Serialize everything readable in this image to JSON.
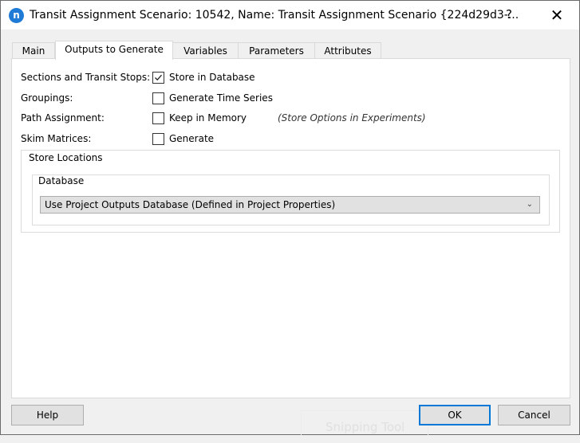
{
  "window": {
    "title": "Transit Assignment Scenario: 10542, Name: Transit Assignment Scenario  {224d29d3-...",
    "app_icon_glyph": "n",
    "help_glyph": "?",
    "close_glyph": "✕"
  },
  "tabs": [
    {
      "label": "Main",
      "active": false
    },
    {
      "label": "Outputs to Generate",
      "active": true
    },
    {
      "label": "Variables",
      "active": false
    },
    {
      "label": "Parameters",
      "active": false
    },
    {
      "label": "Attributes",
      "active": false
    }
  ],
  "outputs": [
    {
      "label": "Sections and Transit Stops:",
      "option": "Store in Database",
      "checked": true
    },
    {
      "label": "Groupings:",
      "option": "Generate Time Series",
      "checked": false
    },
    {
      "label": "Path Assignment:",
      "option": "Keep in Memory",
      "checked": false
    },
    {
      "label": "Skim Matrices:",
      "option": "Generate",
      "checked": false
    }
  ],
  "path_note": "(Store Options in Experiments)",
  "store_locations": {
    "title": "Store Locations",
    "database_group": "Database",
    "database_selected": "Use Project Outputs Database (Defined in Project Properties)"
  },
  "buttons": {
    "help": "Help",
    "ok": "OK",
    "cancel": "Cancel"
  },
  "overlay": {
    "snipping_tool": "Snipping Tool"
  }
}
